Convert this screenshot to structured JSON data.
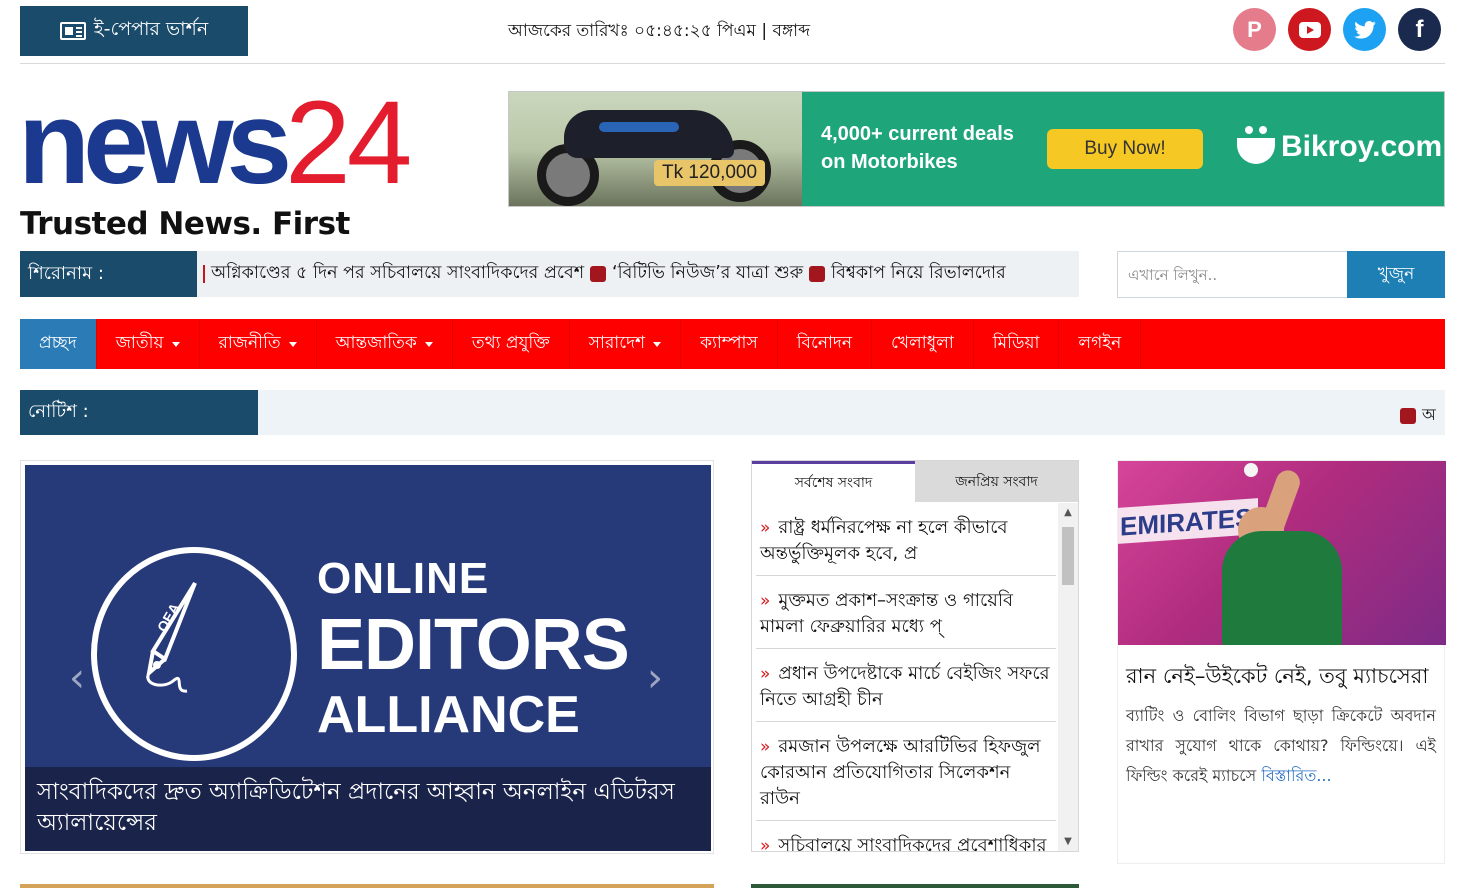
{
  "topbar": {
    "epaper_label": "ই-পেপার ভার্শন",
    "date_text": "আজকের তারিখঃ ০৫:৪৫:২৫ পিএম | বঙ্গাব্দ",
    "social": [
      {
        "name": "pinterest",
        "glyph": "℗",
        "color": "#e57c8b"
      },
      {
        "name": "youtube",
        "color": "#cc181e"
      },
      {
        "name": "twitter",
        "glyph": "🐦",
        "color": "#1da1f2"
      },
      {
        "name": "facebook",
        "glyph": "f",
        "color": "#1a2a4f"
      }
    ]
  },
  "logo": {
    "word": "news",
    "number": "24",
    "tagline": "Trusted News. First",
    "colors": {
      "word": "#1b3a8f",
      "number": "#e31d2e"
    }
  },
  "ad": {
    "price": "Tk 120,000",
    "line1": "4,000+ current deals",
    "line2": "on Motorbikes",
    "button": "Buy Now!",
    "brand": "Bikroy.com",
    "bg_color": "#1fa57a"
  },
  "headline": {
    "label": "শিরোনাম :",
    "items": [
      "অগ্নিকাণ্ডের ৫ দিন পর সচিবালয়ে সাংবাদিকদের প্রবেশ",
      "‘বিটিভি নিউজ’র যাত্রা শুরু",
      "বিশ্বকাপ নিয়ে রিভালদোর"
    ]
  },
  "search": {
    "placeholder": "এখানে লিখুন..",
    "button": "খুজুন"
  },
  "nav": {
    "items": [
      {
        "label": "প্রচ্ছদ",
        "active": true,
        "dropdown": false
      },
      {
        "label": "জাতীয়",
        "dropdown": true
      },
      {
        "label": "রাজনীতি",
        "dropdown": true
      },
      {
        "label": "আন্তজাতিক",
        "dropdown": true
      },
      {
        "label": "তথ্য প্রযুক্তি",
        "dropdown": false
      },
      {
        "label": "সারাদেশ",
        "dropdown": true
      },
      {
        "label": "ক্যাম্পাস",
        "dropdown": false
      },
      {
        "label": "বিনোদন",
        "dropdown": false
      },
      {
        "label": "খেলাধুলা",
        "dropdown": false
      },
      {
        "label": "মিডিয়া",
        "dropdown": false
      },
      {
        "label": "লগইন",
        "dropdown": false
      }
    ],
    "color": "#ff0000",
    "active_color": "#2b7bb6"
  },
  "notice": {
    "label": "নোটিশ :",
    "text": "অ"
  },
  "featured": {
    "logo_line1": "ONLINE",
    "logo_line2": "EDITORS",
    "logo_line3": "ALLIANCE",
    "caption": "সাংবাদিকদের দ্রুত অ্যাক্রিডিটেশন প্রদানের আহ্বান অনলাইন এডিটরস অ্যালায়েন্সের",
    "prev_glyph": "‹",
    "next_glyph": "›"
  },
  "tabs": {
    "latest_label": "সর্বশেষ সংবাদ",
    "popular_label": "জনপ্রিয় সংবাদ",
    "items": [
      "রাষ্ট্র ধর্মনিরপেক্ষ না হলে কীভাবে অন্তর্ভুক্তিমূলক হবে, প্র",
      "মুক্তমত প্রকাশ–সংক্রান্ত ও গায়েবি মামলা ফেব্রুয়ারির মধ্যে প্",
      "প্রধান উপদেষ্টাকে মার্চে বেইজিং সফরে নিতে আগ্রহী চীন",
      "রমজান উপলক্ষে আরটিভির হিফজুল কোরআন প্রতিযোগিতার সিলেকশন রাউন",
      "সচিবালয়ে সাংবাদিকদের প্রবেশাধিকার নিশ্চিতের আহ্বান"
    ]
  },
  "side": {
    "banner_text": "EMIRATES",
    "title": "রান নেই–উইকেট নেই, তবু ম্যাচসেরা",
    "desc": "ব্যাটিং ও বোলিং বিভাগ ছাড়া ক্রিকেটে অবদান রাখার সুযোগ থাকে কোথায়? ফিল্ডিংয়ে। এই ফিল্ডিং করেই ম্যাচসে",
    "more": "বিস্তারিত..."
  }
}
